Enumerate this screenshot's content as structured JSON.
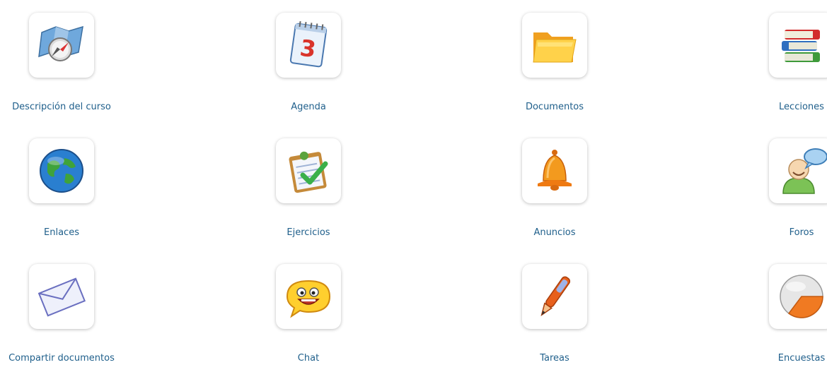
{
  "tools": [
    {
      "label": "Descripción del curso",
      "icon": "course-description-icon"
    },
    {
      "label": "Agenda",
      "icon": "calendar-icon"
    },
    {
      "label": "Documentos",
      "icon": "folder-icon"
    },
    {
      "label": "Lecciones",
      "icon": "books-icon"
    },
    {
      "label": "Enlaces",
      "icon": "globe-icon"
    },
    {
      "label": "Ejercicios",
      "icon": "checklist-icon"
    },
    {
      "label": "Anuncios",
      "icon": "bell-icon"
    },
    {
      "label": "Foros",
      "icon": "forum-user-icon"
    },
    {
      "label": "Compartir documentos",
      "icon": "envelope-icon"
    },
    {
      "label": "Chat",
      "icon": "chat-smiley-icon"
    },
    {
      "label": "Tareas",
      "icon": "pen-icon"
    },
    {
      "label": "Encuestas",
      "icon": "pie-chart-icon"
    }
  ],
  "colors": {
    "label": "#1f5f8b",
    "card_shadow": "#cccccc"
  }
}
